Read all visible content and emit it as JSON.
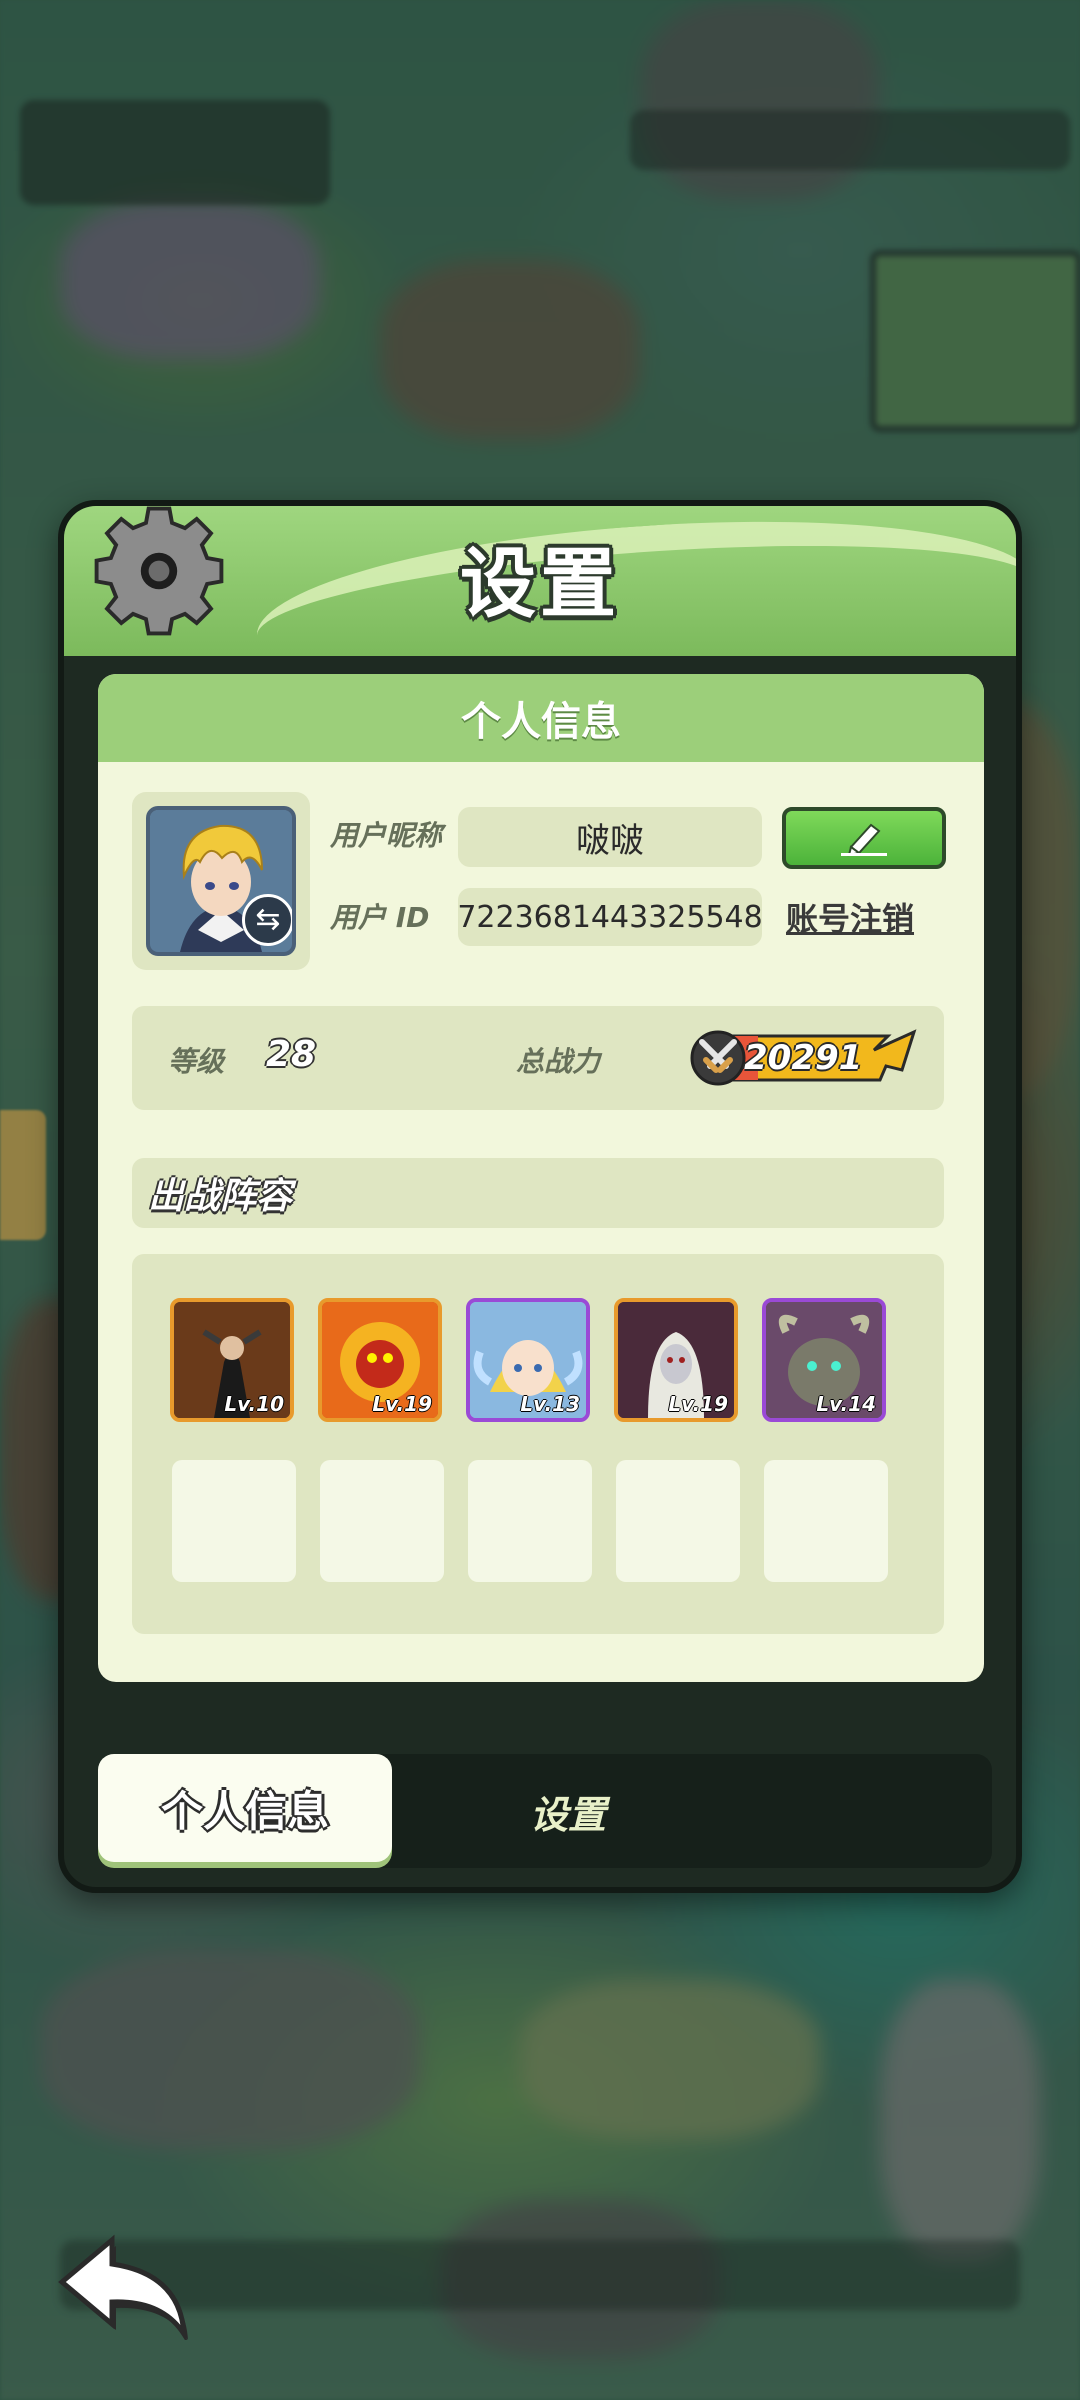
{
  "dialog": {
    "title": "设置",
    "section_title": "个人信息"
  },
  "profile": {
    "nickname_label": "用户昵称",
    "nickname_value": "啵啵",
    "id_label": "用户 ID",
    "id_value": "7223681443325548",
    "cancel_account": "账号注销"
  },
  "stats": {
    "level_label": "等级",
    "level_value": "28",
    "power_label": "总战力",
    "power_value": "20291"
  },
  "lineup": {
    "title": "出战阵容",
    "heroes": [
      {
        "level": "Lv.10",
        "rarity_color": "#e89a2c"
      },
      {
        "level": "Lv.19",
        "rarity_color": "#e89a2c"
      },
      {
        "level": "Lv.13",
        "rarity_color": "#9a4ad6"
      },
      {
        "level": "Lv.19",
        "rarity_color": "#e89a2c"
      },
      {
        "level": "Lv.14",
        "rarity_color": "#9a4ad6"
      }
    ],
    "empty_slots": 5
  },
  "tabs": [
    {
      "label": "个人信息",
      "active": true
    },
    {
      "label": "设置",
      "active": false
    }
  ],
  "icons": {
    "gear": "gear-icon",
    "edit": "pencil-icon",
    "swap": "swap-icon",
    "back": "back-arrow-icon",
    "power": "crossed-swords-icon"
  }
}
